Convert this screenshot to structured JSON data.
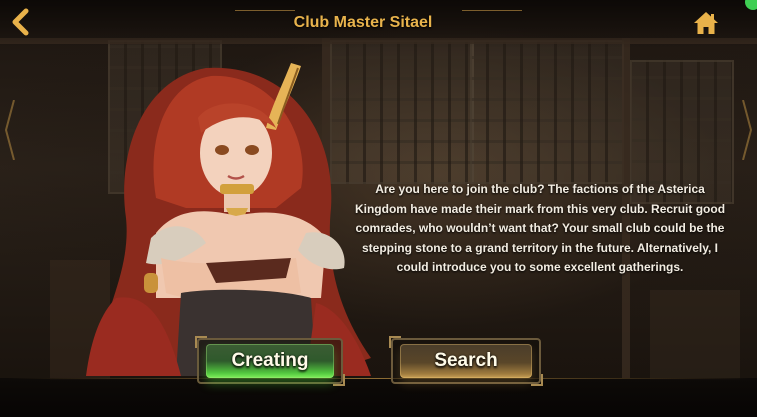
{
  "header": {
    "title": "Club Master Sitael",
    "back_icon": "back-arrow-icon",
    "home_icon": "home-icon"
  },
  "dialog": {
    "text": "Are you here to join the club? The factions of the Asterica Kingdom have made their mark from this very club. Recruit good comrades, who wouldn’t want that? Your small club could be the stepping stone to a grand territory in the future. Alternatively, I could introduce you to some excellent gatherings."
  },
  "buttons": {
    "creating_label": "Creating",
    "search_label": "Search"
  },
  "colors": {
    "title": "#e8b34c",
    "icon": "#e9b24a",
    "creating_button": "#52c63e",
    "search_button": "#a07c3e",
    "dialog_text": "#f3ede2"
  }
}
